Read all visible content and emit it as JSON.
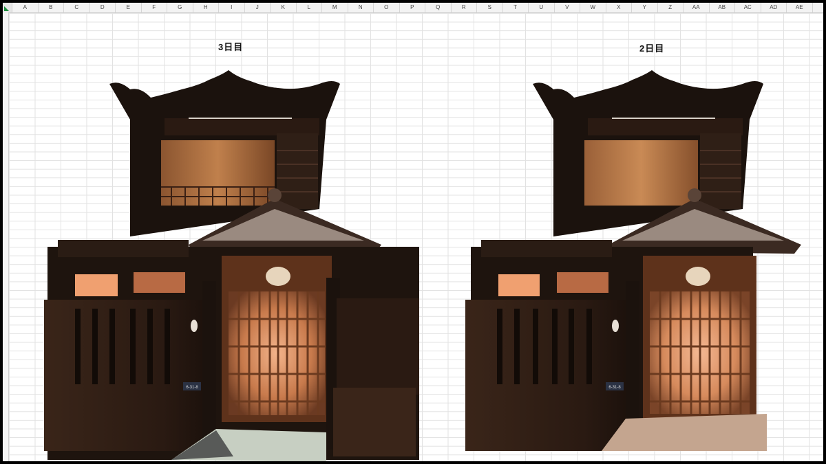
{
  "spreadsheet": {
    "columns": [
      "A",
      "B",
      "C",
      "D",
      "E",
      "F",
      "G",
      "H",
      "I",
      "J",
      "K",
      "L",
      "M",
      "N",
      "O",
      "P",
      "Q",
      "R",
      "S",
      "T",
      "U",
      "V",
      "W",
      "X",
      "Y",
      "Z",
      "AA",
      "AB",
      "AC",
      "AD",
      "AE"
    ]
  },
  "titles": {
    "left": "3日目",
    "right": "2日目"
  },
  "house": {
    "number_plate": "6-31-8",
    "colors": {
      "silhouette": "#1b120d",
      "wood_dark": "#2a1a12",
      "wood_panel": "#a0643a",
      "window_glow": "#f0a070",
      "door_frame": "#6b3a1f",
      "door_glow": "#e9a47a",
      "stone": "#c7cfc2"
    }
  }
}
